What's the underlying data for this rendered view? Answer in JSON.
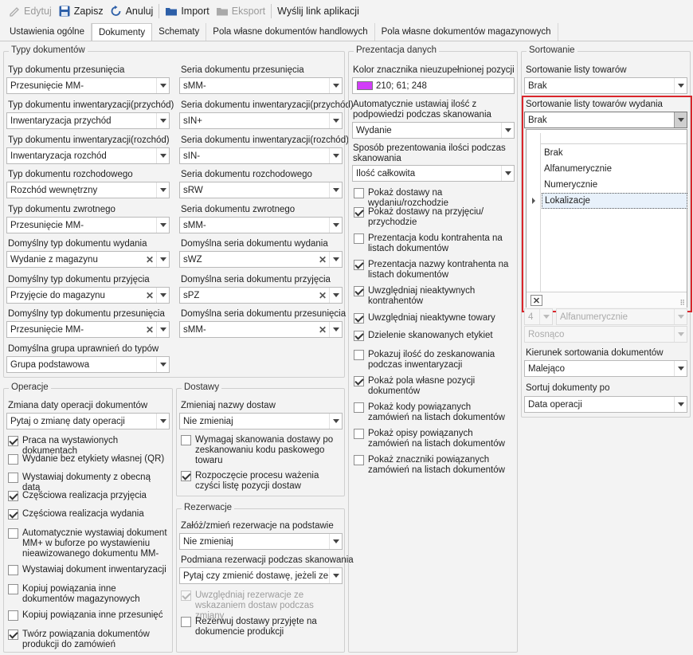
{
  "toolbar": {
    "edit": "Edytuj",
    "save": "Zapisz",
    "cancel": "Anuluj",
    "import": "Import",
    "export": "Eksport",
    "send_link": "Wyślij link aplikacji"
  },
  "tabs": [
    "Ustawienia ogólne",
    "Dokumenty",
    "Schematy",
    "Pola własne dokumentów handlowych",
    "Pola własne dokumentów magazynowych"
  ],
  "types": {
    "title": "Typy dokumentów",
    "rows": [
      {
        "label_l": "Typ dokumentu przesunięcia",
        "value_l": "Przesunięcie MM-",
        "label_r": "Seria dokumentu przesunięcia",
        "value_r": "sMM-"
      },
      {
        "label_l": "Typ dokumentu inwentaryzacji(przychód)",
        "value_l": "Inwentaryzacja przychód",
        "label_r": "Seria dokumentu inwentaryzacji(przychód)",
        "value_r": "sIN+"
      },
      {
        "label_l": "Typ dokumentu inwentaryzacji(rozchód)",
        "value_l": "Inwentaryzacja rozchód",
        "label_r": "Seria dokumentu inwentaryzacji(rozchód)",
        "value_r": "sIN-"
      },
      {
        "label_l": "Typ dokumentu rozchodowego",
        "value_l": "Rozchód wewnętrzny",
        "label_r": "Seria dokumentu rozchodowego",
        "value_r": "sRW"
      },
      {
        "label_l": "Typ dokumentu zwrotnego",
        "value_l": "Przesunięcie MM-",
        "label_r": "Seria dokumentu zwrotnego",
        "value_r": "sMM-"
      },
      {
        "label_l": "Domyślny typ dokumentu wydania",
        "value_l": "Wydanie z magazynu",
        "label_r": "Domyślna seria dokumentu wydania",
        "value_r": "sWZ"
      },
      {
        "label_l": "Domyślny typ dokumentu przyjęcia",
        "value_l": "Przyjęcie do magazynu",
        "label_r": "Domyślna seria dokumentu przyjęcia",
        "value_r": "sPZ"
      },
      {
        "label_l": "Domyślny typ dokumentu przesunięcia",
        "value_l": "Przesunięcie MM-",
        "label_r": "Domyślna seria dokumentu przesunięcia",
        "value_r": "sMM-"
      }
    ],
    "perm_label": "Domyślna grupa uprawnień do typów",
    "perm_value": "Grupa podstawowa"
  },
  "operations": {
    "title": "Operacje",
    "date_label": "Zmiana daty operacji dokumentów",
    "date_value": "Pytaj o zmianę daty operacji",
    "checks": [
      {
        "text": "Praca na wystawionych dokumentach",
        "on": true
      },
      {
        "text": "Wydanie bez etykiety własnej (QR)",
        "on": false
      },
      {
        "text": "Wystawiaj dokumenty z obecną datą",
        "on": false
      },
      {
        "text": "Częściowa realizacja przyjęcia",
        "on": true
      },
      {
        "text": "Częściowa realizacja wydania",
        "on": true
      },
      {
        "text": "Automatycznie wystawiaj dokument MM+ w buforze po wystawieniu nieawizowanego dokumentu MM-",
        "on": false
      },
      {
        "text": "Wystawiaj dokument inwentaryzacji",
        "on": false
      },
      {
        "text": "Kopiuj powiązania inne dokumentów magazynowych",
        "on": false
      },
      {
        "text": "Kopiuj powiązania inne przesunięć",
        "on": false
      },
      {
        "text": "Twórz powiązania dokumentów produkcji do zamówień",
        "on": true
      }
    ]
  },
  "deliveries": {
    "title": "Dostawy",
    "change_label": "Zmieniaj nazwy dostaw",
    "change_value": "Nie zmieniaj",
    "checks": [
      {
        "text": "Wymagaj skanowania dostawy po zeskanowaniu kodu paskowego towaru",
        "on": false
      },
      {
        "text": "Rozpoczęcie procesu ważenia czyści listę pozycji dostaw",
        "on": true
      }
    ]
  },
  "reservations": {
    "title": "Rezerwacje",
    "create_label": "Załóż/zmień rezerwacje na podstawie",
    "create_value": "Nie zmieniaj",
    "swap_label": "Podmiana rezerwacji podczas skanowania",
    "swap_value": "Pytaj czy zmienić dostawę, jeżeli ze...",
    "checks": [
      {
        "text": "Uwzględniaj rezerwacje ze wskazaniem dostaw podczas zmiany",
        "on": true,
        "disabled": true
      },
      {
        "text": "Rezerwuj dostawy przyjęte na dokumencie produkcji",
        "on": false
      }
    ]
  },
  "presentation": {
    "title": "Prezentacja danych",
    "color_label": "Kolor znacznika nieuzupełnionej pozycji",
    "color_value": "210; 61; 248",
    "color_hex": "#d23df8",
    "auto_qty_label": "Automatycznie ustawiaj ilość z podpowiedzi podczas skanowania",
    "auto_qty_value": "Wydanie",
    "qty_mode_label": "Sposób prezentowania ilości podczas skanowania",
    "qty_mode_value": "Ilość całkowita",
    "checks": [
      {
        "text": "Pokaż dostawy na wydaniu/rozchodzie",
        "on": false
      },
      {
        "text": "Pokaż dostawy na przyjęciu/ przychodzie",
        "on": true
      },
      {
        "text": "Prezentacja kodu kontrahenta na listach dokumentów",
        "on": false
      },
      {
        "text": "Prezentacja nazwy kontrahenta na listach dokumentów",
        "on": true
      },
      {
        "text": "Uwzględniaj nieaktywnych kontrahentów",
        "on": true
      },
      {
        "text": "Uwzględniaj nieaktywne towary",
        "on": true
      },
      {
        "text": "Dzielenie skanowanych etykiet",
        "on": true
      },
      {
        "text": "Pokazuj ilość do zeskanowania podczas inwentaryzacji",
        "on": false
      },
      {
        "text": "Pokaż pola własne pozycji dokumentów",
        "on": true
      },
      {
        "text": "Pokaż kody powiązanych zamówień na listach dokumentów",
        "on": false
      },
      {
        "text": "Pokaż opisy powiązanych zamówień na listach dokumentów",
        "on": false
      },
      {
        "text": "Pokaż znaczniki powiązanych zamówień na listach dokumentów",
        "on": false
      }
    ]
  },
  "sorting": {
    "title": "Sortowanie",
    "list_label": "Sortowanie listy towarów",
    "list_value": "Brak",
    "issue_label": "Sortowanie listy towarów wydania",
    "issue_value": "Brak",
    "options": [
      "Brak",
      "Alfanumerycznie",
      "Numerycznie",
      "Lokalizacje"
    ],
    "selected_option": "Lokalizacje",
    "hidden_num": "4",
    "hidden_value": "Alfanumerycznie",
    "order_value": "Rosnąco",
    "doc_dir_label": "Kierunek sortowania dokumentów",
    "doc_dir_value": "Malejąco",
    "doc_by_label": "Sortuj dokumenty po",
    "doc_by_value": "Data operacji",
    "highlight_color": "#d9262b"
  }
}
